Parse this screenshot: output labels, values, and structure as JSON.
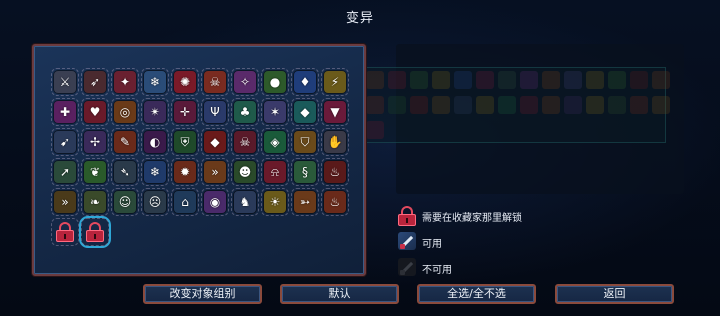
{
  "title": "变异",
  "grid": {
    "rows": [
      [
        {
          "icon": "sword-sparkle-icon",
          "bg": "#3a3f52",
          "glyph": "⚔"
        },
        {
          "icon": "crossbow-icon",
          "bg": "#4a2a2f",
          "glyph": "➶"
        },
        {
          "icon": "red-blade-icon",
          "bg": "#6a2030",
          "glyph": "✦"
        },
        {
          "icon": "ice-sword-icon",
          "bg": "#2a4c78",
          "glyph": "❄"
        },
        {
          "icon": "red-rune-icon",
          "bg": "#7a1a28",
          "glyph": "✺"
        },
        {
          "icon": "fire-skull-icon",
          "bg": "#7a2b20",
          "glyph": "☠"
        },
        {
          "icon": "magic-wand-icon",
          "bg": "#5a2a6a",
          "glyph": "✧"
        },
        {
          "icon": "green-orb-icon",
          "bg": "#2d5a2a",
          "glyph": "●"
        },
        {
          "icon": "blue-potion-icon",
          "bg": "#1f3d7a",
          "glyph": "♦"
        },
        {
          "icon": "lightning-icon",
          "bg": "#6a5a1a",
          "glyph": "⚡"
        }
      ],
      [
        {
          "icon": "purple-flask-icon",
          "bg": "#5a2060",
          "glyph": "✚"
        },
        {
          "icon": "blood-drop-icon",
          "bg": "#6a1a2a",
          "glyph": "♥"
        },
        {
          "icon": "orange-ring-icon",
          "bg": "#6a3a18",
          "glyph": "◎"
        },
        {
          "icon": "shadow-claw-icon",
          "bg": "#3a2a5a",
          "glyph": "✴"
        },
        {
          "icon": "crosshair-icon",
          "bg": "#5a1a3a",
          "glyph": "✛"
        },
        {
          "icon": "trident-icon",
          "bg": "#2a3a6a",
          "glyph": "Ψ"
        },
        {
          "icon": "green-beast-icon",
          "bg": "#1f5a4a",
          "glyph": "♣"
        },
        {
          "icon": "star-burst-icon",
          "bg": "#3a3a6a",
          "glyph": "✶"
        },
        {
          "icon": "teal-slime-icon",
          "bg": "#1a5a5a",
          "glyph": "◆"
        },
        {
          "icon": "vampire-fang-icon",
          "bg": "#6a1a3a",
          "glyph": "▼"
        }
      ],
      [
        {
          "icon": "arrow-rain-icon",
          "bg": "#2a3a5a",
          "glyph": "➹"
        },
        {
          "icon": "poison-dagger-icon",
          "bg": "#3a2a5a",
          "glyph": "✢"
        },
        {
          "icon": "flame-sword-icon",
          "bg": "#6a2a1a",
          "glyph": "✎"
        },
        {
          "icon": "shadow-mask-icon",
          "bg": "#3a1a4a",
          "glyph": "◐"
        },
        {
          "icon": "green-shield-icon",
          "bg": "#1f4a2a",
          "glyph": "⛨"
        },
        {
          "icon": "red-gem-icon",
          "bg": "#6a1a1a",
          "glyph": "◆"
        },
        {
          "icon": "skull-crossbones-icon",
          "bg": "#5a1a2a",
          "glyph": "☠"
        },
        {
          "icon": "emerald-icon",
          "bg": "#1a5a3a",
          "glyph": "◈"
        },
        {
          "icon": "golden-shield-icon",
          "bg": "#6a4a1a",
          "glyph": "⛉"
        },
        {
          "icon": "white-claw-icon",
          "bg": "#3a3a48",
          "glyph": "✋"
        }
      ],
      [
        {
          "icon": "spear-icon",
          "bg": "#2a4a3a",
          "glyph": "➚"
        },
        {
          "icon": "vine-icon",
          "bg": "#2a5a2a",
          "glyph": "❦"
        },
        {
          "icon": "wind-blade-icon",
          "bg": "#2a3a4a",
          "glyph": "➴"
        },
        {
          "icon": "ice-shard-icon",
          "bg": "#1f3a6a",
          "glyph": "❄"
        },
        {
          "icon": "fire-bomb-icon",
          "bg": "#6a2a1a",
          "glyph": "✹"
        },
        {
          "icon": "double-arrow-icon",
          "bg": "#6a3a1a",
          "glyph": "»"
        },
        {
          "icon": "ogre-icon",
          "bg": "#2a4a2a",
          "glyph": "☻"
        },
        {
          "icon": "red-bell-icon",
          "bg": "#6a1a2a",
          "glyph": "⍾"
        },
        {
          "icon": "tentacle-icon",
          "bg": "#2a5a3a",
          "glyph": "§"
        },
        {
          "icon": "blood-vial-icon",
          "bg": "#5a1a1a",
          "glyph": "♨"
        }
      ],
      [
        {
          "icon": "speed-arrows-icon",
          "bg": "#4a3a1a",
          "glyph": "»"
        },
        {
          "icon": "leaf-icon",
          "bg": "#3a4a2a",
          "glyph": "❧"
        },
        {
          "icon": "mask-icon",
          "bg": "#2a4a3a",
          "glyph": "☺"
        },
        {
          "icon": "ghost-icon",
          "bg": "#2a3a4a",
          "glyph": "☹"
        },
        {
          "icon": "temple-icon",
          "bg": "#1f3a5a",
          "glyph": "⌂"
        },
        {
          "icon": "purple-orb-icon",
          "bg": "#4a2a6a",
          "glyph": "◉"
        },
        {
          "icon": "knight-icon",
          "bg": "#2a3a5a",
          "glyph": "♞"
        },
        {
          "icon": "sun-icon",
          "bg": "#6a5a1a",
          "glyph": "☀"
        },
        {
          "icon": "fire-arrow-icon",
          "bg": "#6a3a1a",
          "glyph": "➳"
        },
        {
          "icon": "fire-spirit-icon",
          "bg": "#6a2a1a",
          "glyph": "♨"
        }
      ]
    ],
    "locked_count": 2
  },
  "legend": [
    {
      "icon": "lock-icon",
      "label": "需要在收藏家那里解锁"
    },
    {
      "icon": "sword-icon-available",
      "label": "可用"
    },
    {
      "icon": "sword-icon-unavailable",
      "label": "不可用"
    }
  ],
  "buttons": {
    "change_group": "改变对象组别",
    "default": "默认",
    "toggle_all": "全选/全不选",
    "back": "返回"
  }
}
